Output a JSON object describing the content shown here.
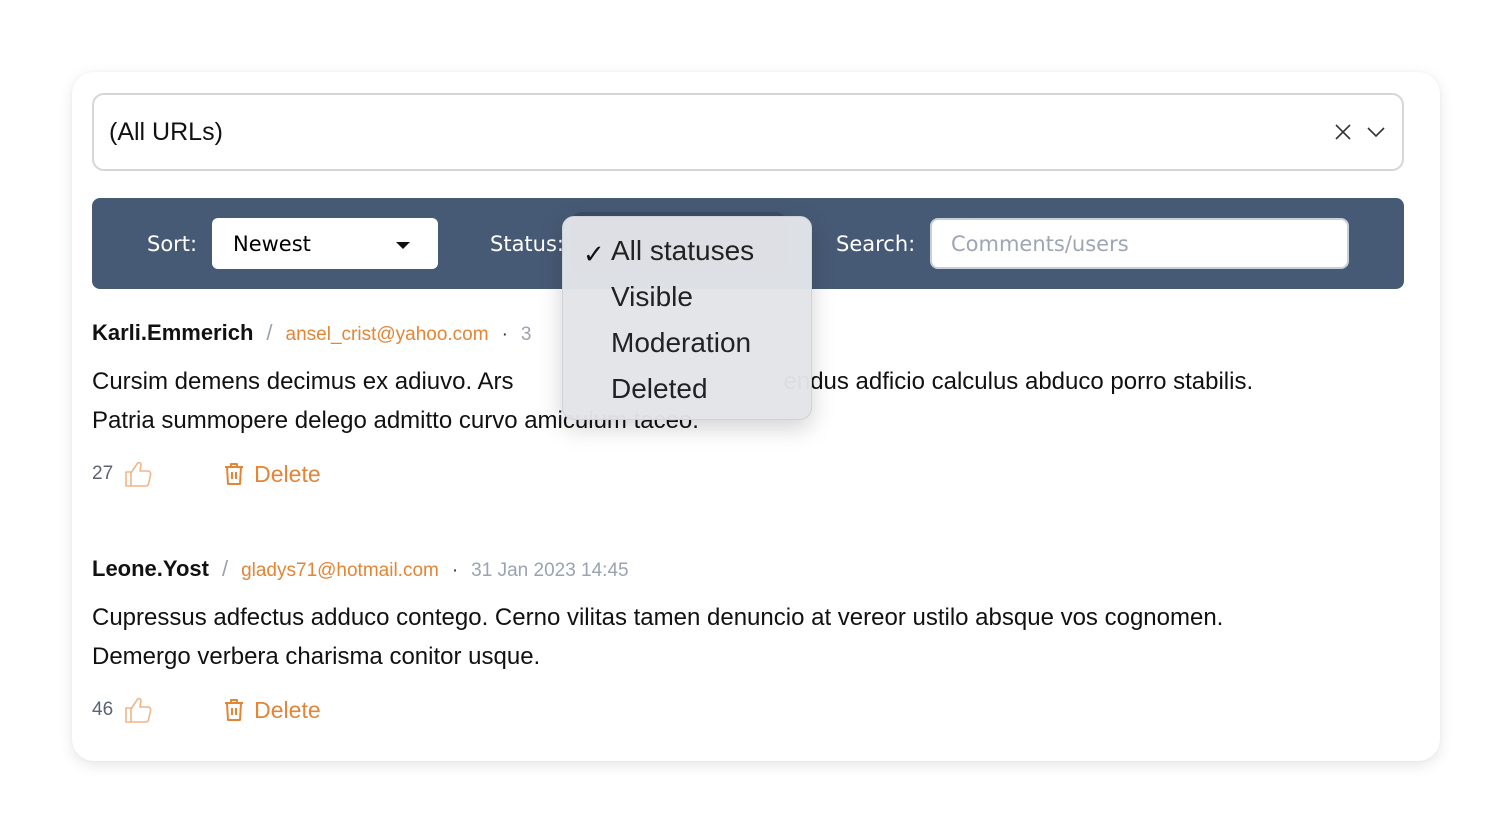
{
  "url_filter": {
    "value": "(All URLs)",
    "clear_icon": "close-icon",
    "expand_icon": "chevron-down-icon"
  },
  "toolbar": {
    "sort_label": "Sort:",
    "sort_value": "Newest",
    "status_label": "Status:",
    "search_label": "Search:",
    "search_placeholder": "Comments/users",
    "search_value": ""
  },
  "status_dropdown": {
    "selected_index": 0,
    "check_glyph": "✓",
    "options": [
      "All statuses",
      "Visible",
      "Moderation",
      "Deleted"
    ]
  },
  "comments": [
    {
      "user": "Karli.Emmerich",
      "email": "ansel_crist@yahoo.com",
      "date": "3",
      "body": "Cursim demens decimus ex adiuvo. Ars ... endus adficio calculus abduco porro stabilis. Patria summopere delego admitto curvo amiculum taceo.",
      "body_line1_left": "Cursim demens decimus ex adiuvo. Ars",
      "body_line1_right": "endus adficio calculus abduco porro stabilis.",
      "body_line2": "Patria summopere delego admitto curvo amiculum taceo.",
      "likes": "27",
      "delete_label": "Delete"
    },
    {
      "user": "Leone.Yost",
      "email": "gladys71@hotmail.com",
      "date": "31 Jan 2023 14:45",
      "body_line1": "Cupressus adfectus adduco contego. Cerno vilitas tamen denuncio at vereor ustilo absque vos cognomen.",
      "body_line2": "Demergo verbera charisma conitor usque.",
      "likes": "46",
      "delete_label": "Delete"
    }
  ],
  "separators": {
    "slash": "/",
    "dot": "·"
  },
  "colors": {
    "toolbar_bg": "#475a75",
    "accent_orange": "#e38536",
    "muted_gray": "#9aa3b0"
  }
}
